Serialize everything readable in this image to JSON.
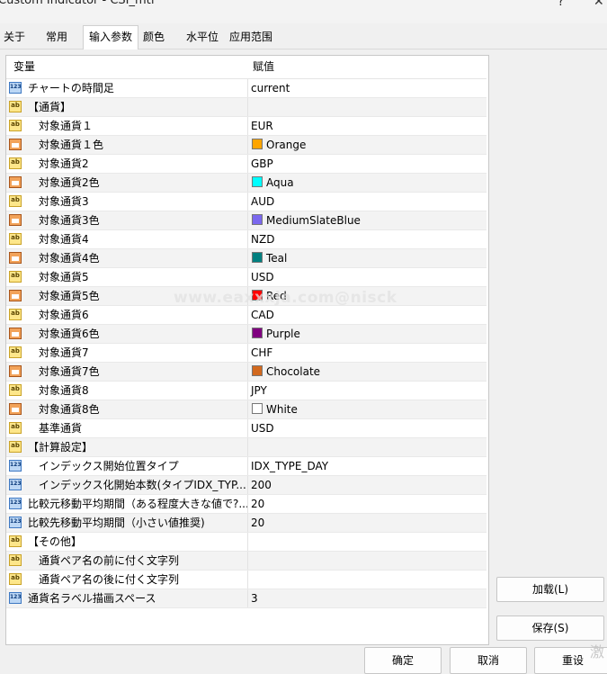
{
  "window": {
    "title": "Custom Indicator - CSI_mtf",
    "help": "?",
    "close": "✕"
  },
  "tabs": [
    {
      "label": "关于"
    },
    {
      "label": "常用"
    },
    {
      "label": "输入参数"
    },
    {
      "label": "颜色"
    },
    {
      "label": "水平位"
    },
    {
      "label": "应用范围"
    }
  ],
  "active_tab": "输入参数",
  "table": {
    "headers": {
      "variable": "变量",
      "value": "赋值"
    },
    "rows": [
      {
        "type": "num",
        "indent": false,
        "name": "チャートの時間足",
        "value": "current"
      },
      {
        "type": "ab",
        "indent": false,
        "name": "【通貨】",
        "value": ""
      },
      {
        "type": "ab",
        "indent": true,
        "name": "対象通貨１",
        "value": "EUR"
      },
      {
        "type": "color",
        "indent": true,
        "name": "対象通貨１色",
        "value": "Orange",
        "swatch": "#ffa500"
      },
      {
        "type": "ab",
        "indent": true,
        "name": "対象通貨2",
        "value": "GBP"
      },
      {
        "type": "color",
        "indent": true,
        "name": "対象通貨2色",
        "value": "Aqua",
        "swatch": "#00ffff"
      },
      {
        "type": "ab",
        "indent": true,
        "name": "対象通貨3",
        "value": "AUD"
      },
      {
        "type": "color",
        "indent": true,
        "name": "対象通貨3色",
        "value": "MediumSlateBlue",
        "swatch": "#7b68ee"
      },
      {
        "type": "ab",
        "indent": true,
        "name": "対象通貨4",
        "value": "NZD"
      },
      {
        "type": "color",
        "indent": true,
        "name": "対象通貨4色",
        "value": "Teal",
        "swatch": "#008080"
      },
      {
        "type": "ab",
        "indent": true,
        "name": "対象通貨5",
        "value": "USD"
      },
      {
        "type": "color",
        "indent": true,
        "name": "対象通貨5色",
        "value": "Red",
        "swatch": "#ff0000"
      },
      {
        "type": "ab",
        "indent": true,
        "name": "対象通貨6",
        "value": "CAD"
      },
      {
        "type": "color",
        "indent": true,
        "name": "対象通貨6色",
        "value": "Purple",
        "swatch": "#800080"
      },
      {
        "type": "ab",
        "indent": true,
        "name": "対象通貨7",
        "value": "CHF"
      },
      {
        "type": "color",
        "indent": true,
        "name": "対象通貨7色",
        "value": "Chocolate",
        "swatch": "#d2691e"
      },
      {
        "type": "ab",
        "indent": true,
        "name": "対象通貨8",
        "value": "JPY"
      },
      {
        "type": "color",
        "indent": true,
        "name": "対象通貨8色",
        "value": "White",
        "swatch": "#ffffff"
      },
      {
        "type": "ab",
        "indent": true,
        "name": "基準通貨",
        "value": "USD"
      },
      {
        "type": "ab",
        "indent": false,
        "name": "【計算設定】",
        "value": ""
      },
      {
        "type": "num",
        "indent": true,
        "name": "インデックス開始位置タイプ",
        "value": "IDX_TYPE_DAY"
      },
      {
        "type": "num",
        "indent": true,
        "name": "インデックス化開始本数(タイプIDX_TYP...",
        "value": "200"
      },
      {
        "type": "num",
        "indent": false,
        "name": "比較元移動平均期間（ある程度大きな値で?...",
        "value": "20"
      },
      {
        "type": "num",
        "indent": false,
        "name": "比較先移動平均期間（小さい値推奨)",
        "value": "20"
      },
      {
        "type": "ab",
        "indent": false,
        "name": "【その他】",
        "value": ""
      },
      {
        "type": "ab",
        "indent": true,
        "name": "通貨ペア名の前に付く文字列",
        "value": ""
      },
      {
        "type": "ab",
        "indent": true,
        "name": "通貨ペア名の後に付く文字列",
        "value": ""
      },
      {
        "type": "num",
        "indent": false,
        "name": "通貨名ラベル描画スペース",
        "value": "3"
      }
    ]
  },
  "watermark": "www.eaxxxja.com@nisck",
  "buttons": {
    "load": "加载(L)",
    "save": "保存(S)",
    "ok": "确定",
    "cancel": "取消",
    "reset": "重设"
  },
  "corner_text": "激"
}
